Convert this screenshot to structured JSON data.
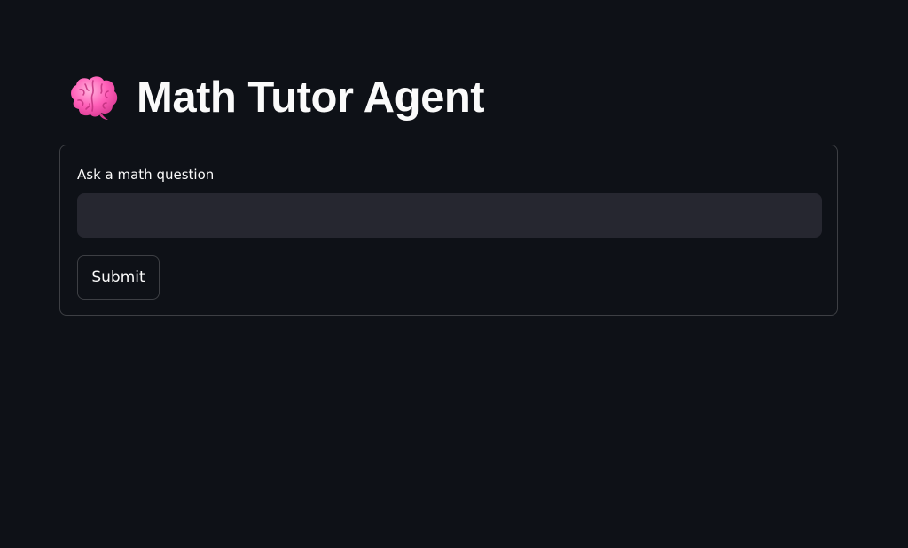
{
  "header": {
    "icon": "brain-icon",
    "title": "Math Tutor Agent"
  },
  "form": {
    "question_label": "Ask a math question",
    "question_value": "",
    "question_placeholder": "",
    "submit_label": "Submit"
  },
  "colors": {
    "background": "#0e1117",
    "input_background": "#262730",
    "text": "#fafafa",
    "brain_pink": "#ff5fb8"
  }
}
